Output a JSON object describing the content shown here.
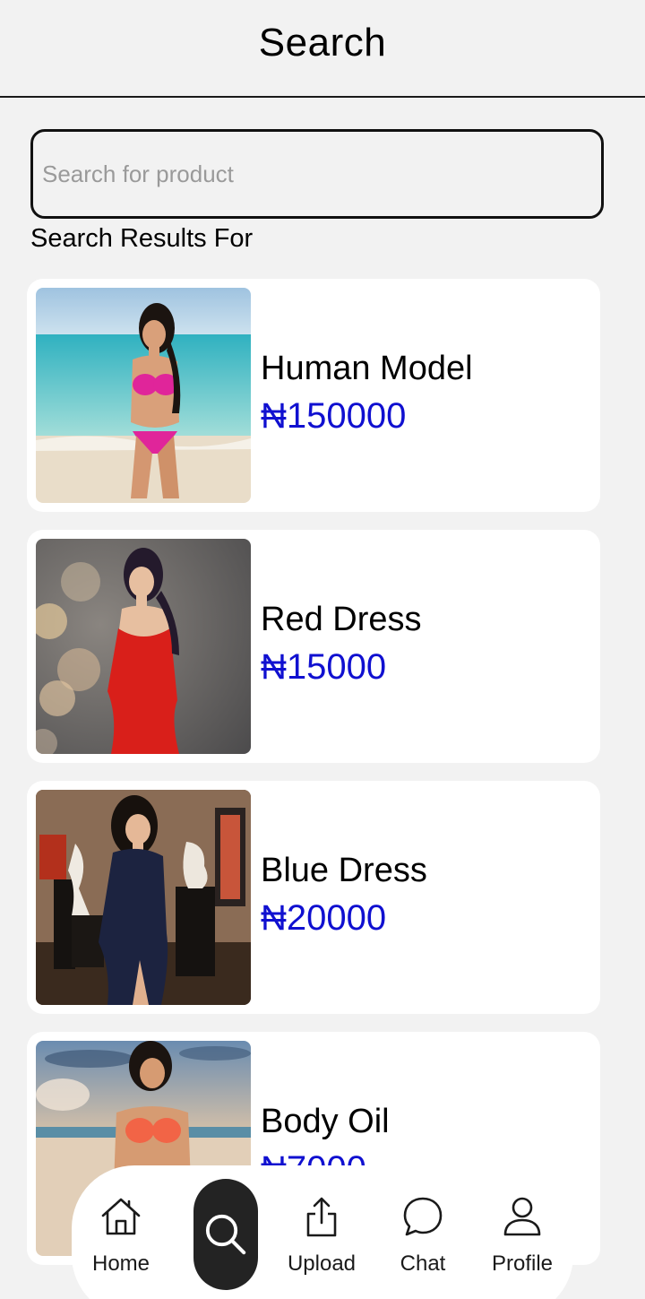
{
  "header": {
    "title": "Search"
  },
  "search": {
    "placeholder": "Search for product",
    "value": ""
  },
  "results_label": "Search Results For",
  "products": [
    {
      "name": "Human Model",
      "price": "₦150000",
      "image": "woman-in-pink-bikini-on-beach"
    },
    {
      "name": "Red Dress",
      "price": "₦15000",
      "image": "woman-in-red-dress-bokeh"
    },
    {
      "name": "Blue Dress",
      "price": "₦20000",
      "image": "woman-in-navy-dress-gallery"
    },
    {
      "name": "Body Oil",
      "price": "₦7000",
      "image": "woman-on-beach-sunset"
    }
  ],
  "nav": {
    "home": "Home",
    "upload": "Upload",
    "chat": "Chat",
    "profile": "Profile"
  },
  "colors": {
    "price": "#1010d0",
    "background": "#f2f2f2",
    "card": "#ffffff",
    "active_nav": "#232323"
  }
}
